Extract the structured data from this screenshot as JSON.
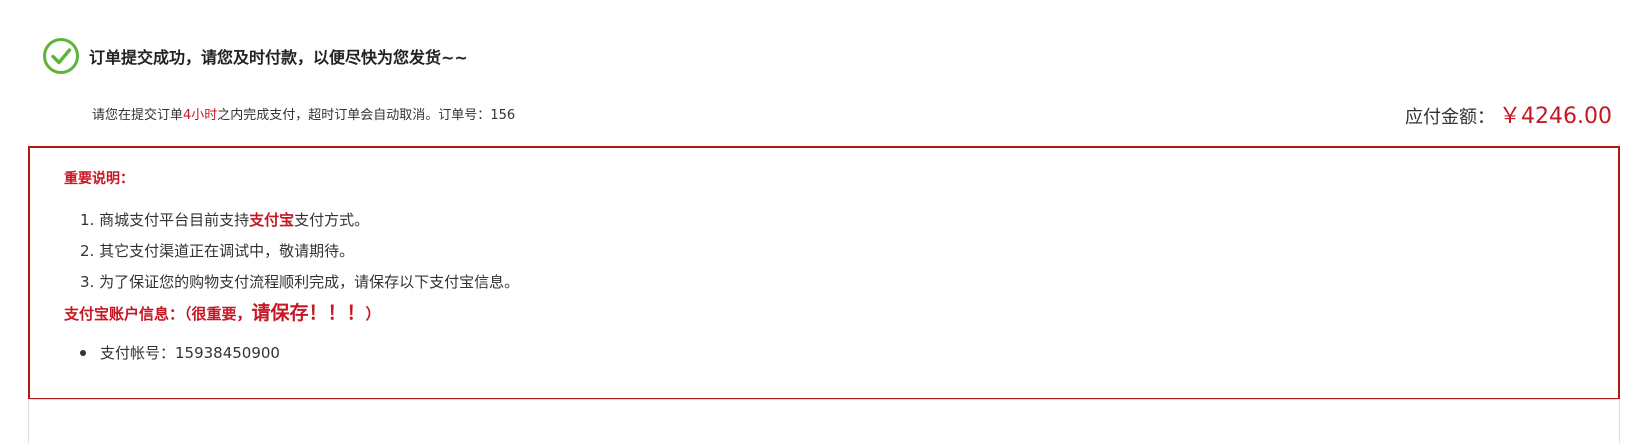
{
  "success": {
    "message": "订单提交成功，请您及时付款，以便尽快为您发货~~",
    "icon": "check-circle-icon",
    "icon_color": "#5fb336"
  },
  "notice": {
    "prefix": "请您在提交订单",
    "highlight": "4小时",
    "suffix": "之内完成支付，超时订单会自动取消。订单号：",
    "order_no": "156"
  },
  "payment": {
    "label": "应付金额：",
    "amount": "￥4246.00"
  },
  "important": {
    "title": "重要说明：",
    "items": [
      {
        "prefix": "1. 商城支付平台目前支持",
        "highlight": "支付宝",
        "suffix": "支付方式。"
      },
      {
        "text": "2. 其它支付渠道正在调试中，敬请期待。"
      },
      {
        "text": "3. 为了保证您的购物支付流程顺利完成，请保存以下支付宝信息。"
      }
    ]
  },
  "account": {
    "title_prefix": "支付宝账户信息：（很重要，",
    "title_emphasis": "请保存！！！",
    "title_suffix": "）",
    "items": [
      {
        "text": "支付帐号：15938450900"
      }
    ]
  },
  "colors": {
    "accent_red": "#c81623",
    "box_border": "#b1191a",
    "success_green": "#5fb336"
  }
}
